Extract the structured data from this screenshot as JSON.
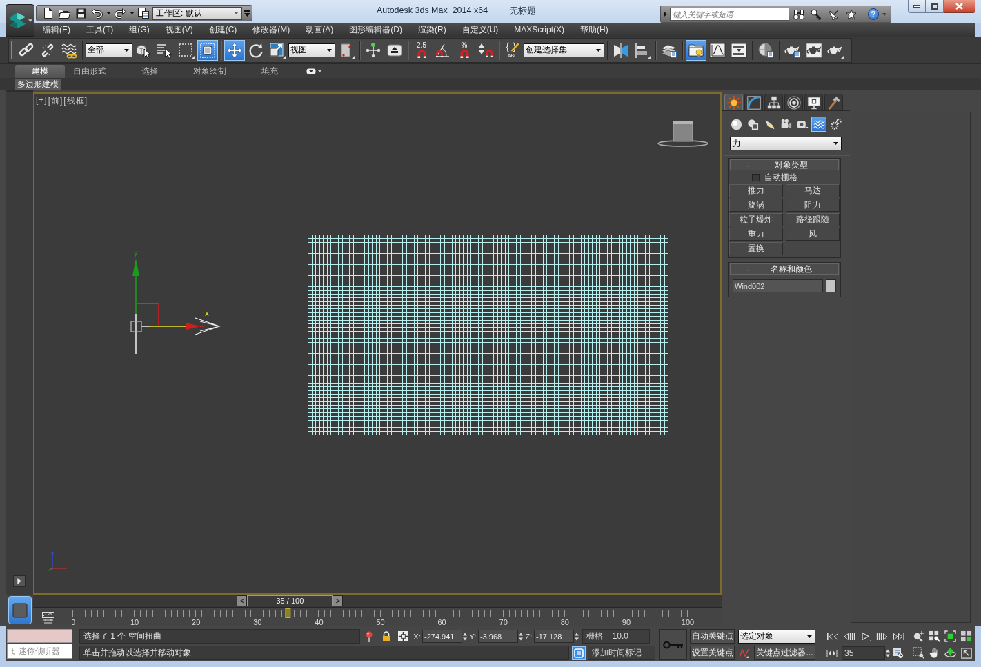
{
  "window": {
    "app_title": "Autodesk 3ds Max  2014 x64",
    "document_title": "无标题"
  },
  "quick_access": {
    "workspace": "工作区: 默认"
  },
  "infocenter": {
    "search_placeholder": "键入关键字或短语",
    "help": "?"
  },
  "menu": [
    "编辑(E)",
    "工具(T)",
    "组(G)",
    "视图(V)",
    "创建(C)",
    "修改器(M)",
    "动画(A)",
    "图形编辑器(D)",
    "渲染(R)",
    "自定义(U)",
    "MAXScript(X)",
    "帮助(H)"
  ],
  "main_toolbar": [
    [
      {
        "kind": "button",
        "selected": false
      },
      {
        "kind": "button",
        "selected": false
      },
      {
        "kind": "button",
        "selected": false
      }
    ],
    [
      {
        "kind": "dropdown",
        "value": "全部"
      },
      {
        "kind": "button",
        "selected": false
      },
      {
        "kind": "button",
        "selected": false
      },
      {
        "kind": "button",
        "selected": false
      },
      {
        "kind": "button",
        "selected": true
      }
    ],
    [
      {
        "kind": "button",
        "selected": true
      },
      {
        "kind": "button",
        "selected": false
      },
      {
        "kind": "button",
        "selected": false
      },
      {
        "kind": "dropdown",
        "value": "视图"
      },
      {
        "kind": "button",
        "selected": false
      }
    ],
    [
      {
        "kind": "button",
        "selected": false
      },
      {
        "kind": "button",
        "selected": false
      }
    ],
    [
      {
        "kind": "button",
        "selected": false,
        "label": "2.5"
      },
      {
        "kind": "button",
        "selected": false
      },
      {
        "kind": "button",
        "selected": false,
        "label": "%"
      },
      {
        "kind": "button",
        "selected": false
      }
    ],
    [
      {
        "kind": "button",
        "selected": false,
        "label": "ABC"
      },
      {
        "kind": "dropdown",
        "value": "创建选择集"
      }
    ],
    [
      {
        "kind": "button",
        "selected": false
      },
      {
        "kind": "button",
        "selected": false
      }
    ],
    [
      {
        "kind": "button",
        "selected": false
      }
    ],
    [
      {
        "kind": "button",
        "selected": true
      },
      {
        "kind": "button",
        "selected": false
      },
      {
        "kind": "button",
        "selected": false
      }
    ],
    [
      {
        "kind": "button",
        "selected": false
      }
    ],
    [
      {
        "kind": "button",
        "selected": false
      },
      {
        "kind": "button",
        "selected": false
      },
      {
        "kind": "button",
        "selected": false
      }
    ]
  ],
  "ribbon": {
    "tabs": [
      {
        "label": "建模",
        "selected": true
      },
      {
        "label": "自由形式",
        "selected": false
      },
      {
        "label": "选择",
        "selected": false
      },
      {
        "label": "对象绘制",
        "selected": false
      },
      {
        "label": "填充",
        "selected": false
      }
    ],
    "panel": "多边形建模"
  },
  "viewport": {
    "labels": [
      "[+]",
      "[前]",
      "[线框]"
    ],
    "axis_labels": [
      "y",
      "x"
    ]
  },
  "command_panel": {
    "tabs": [
      {
        "selected": true
      },
      {
        "selected": false
      },
      {
        "selected": false
      },
      {
        "selected": false
      },
      {
        "selected": false
      },
      {
        "selected": false
      }
    ],
    "categories": [
      {
        "selected": false
      },
      {
        "selected": false
      },
      {
        "selected": false
      },
      {
        "selected": false
      },
      {
        "selected": false
      },
      {
        "selected": true
      },
      {
        "selected": false
      }
    ],
    "category": "力",
    "object_type": {
      "title": "对象类型",
      "collapse": "-",
      "auto_grid": {
        "label": "自动栅格",
        "checked": false
      },
      "buttons": [
        "推力",
        "马达",
        "旋涡",
        "阻力",
        "粒子爆炸",
        "路径跟随",
        "重力",
        "风",
        "置换"
      ]
    },
    "name_and_color": {
      "title": "名称和颜色",
      "collapse": "-",
      "name": "Wind002",
      "color": "#c4c4c4"
    }
  },
  "layout_tabs": [
    {
      "selected": true
    }
  ],
  "timeline": {
    "time_slider": {
      "previous": "<",
      "label": "35 / 100",
      "next": ">",
      "level": 0.35
    },
    "frame_labels": [
      "0",
      "10",
      "20",
      "30",
      "40",
      "50",
      "60",
      "70",
      "80",
      "90",
      "100"
    ]
  },
  "status_bar": {
    "listener_placeholder": "迷你侦听器",
    "status": "选择了 1 个 空间扭曲",
    "prompt": "单击并拖动以选择并移动对象",
    "coordinates": [
      {
        "axis": "X:",
        "value": "-274.941"
      },
      {
        "axis": "Y:",
        "value": "-3.968"
      },
      {
        "axis": "Z:",
        "value": "-17.128"
      }
    ],
    "grid": "栅格 = 10.0",
    "toggle": {
      "on": true
    },
    "time_tag": "添加时间标记",
    "auto_key": {
      "label": "自动关键点",
      "on": false
    },
    "key_set": "选定对象",
    "set_key": "设置关键点",
    "key_filters": "关键点过滤器...",
    "frame": "35"
  }
}
